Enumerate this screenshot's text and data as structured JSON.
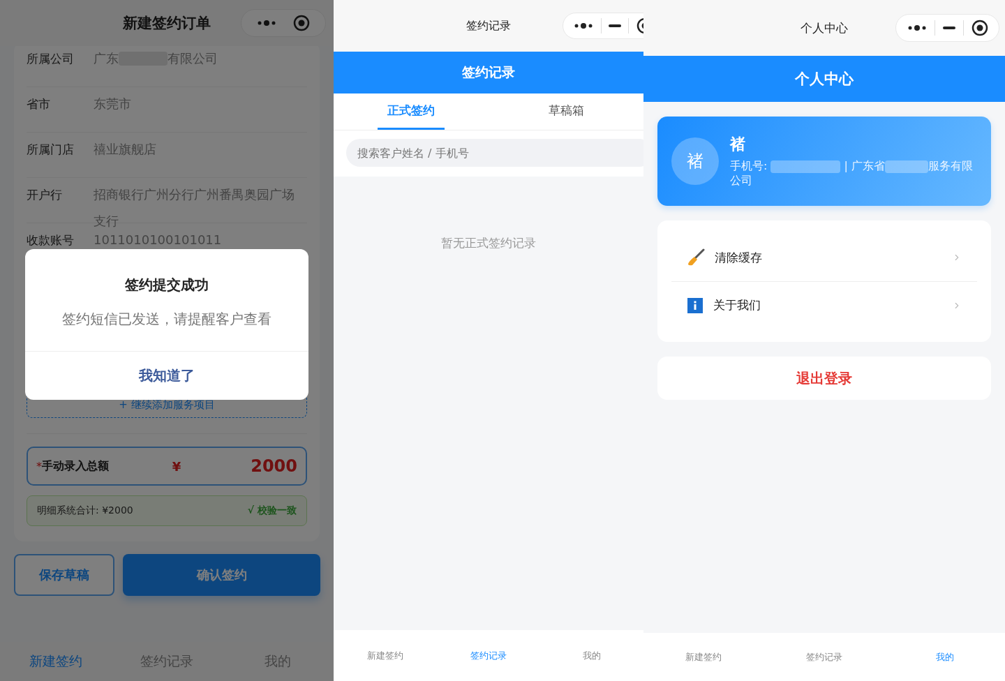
{
  "new_order_screen": {
    "nav_title": "新建签约订单",
    "fields": [
      {
        "label": "所属公司",
        "value": "广东",
        "value_after": "有限公司"
      },
      {
        "label": "省市",
        "value": "东莞市"
      },
      {
        "label": "所属门店",
        "value": "禧业旗舰店"
      },
      {
        "label": "开户行",
        "value": "招商银行广州分行广州番禺奥园广场支行"
      },
      {
        "label": "收款账号",
        "value": "1011010100101011"
      }
    ],
    "add_service": "+ 继续添加服务项目",
    "total": {
      "required_mark": "*",
      "label": "手动录入总额",
      "currency": "¥",
      "value": "2000"
    },
    "check": {
      "summary": "明细系统合计: ¥2000",
      "status": "√ 校验一致"
    },
    "buttons": [
      {
        "label": "保存草稿",
        "kind": "outline"
      },
      {
        "label": "确认签约",
        "kind": "primary"
      }
    ],
    "dialog": {
      "title": "签约提交成功",
      "message": "签约短信已发送，请提醒客户查看",
      "button": "我知道了"
    },
    "tab_bar": [
      {
        "label": "新建签约",
        "selected": true
      },
      {
        "label": "签约记录",
        "selected": false
      },
      {
        "label": "我的",
        "selected": false
      }
    ]
  },
  "records_screen": {
    "nav_title": "签约记录",
    "header": "签约记录",
    "tabs": [
      {
        "label": "正式签约",
        "selected": true
      },
      {
        "label": "草稿箱",
        "selected": false
      }
    ],
    "search": {
      "placeholder": "搜索客户姓名 / 手机号"
    },
    "empty_text": "暂无正式签约记录",
    "tab_bar": [
      {
        "label": "新建签约",
        "selected": false
      },
      {
        "label": "签约记录",
        "selected": true
      },
      {
        "label": "我的",
        "selected": false
      }
    ]
  },
  "profile_screen": {
    "nav_title": "个人中心",
    "header": "个人中心",
    "profile": {
      "avatar": "褚",
      "name": "褚",
      "phone_label": "手机号:",
      "company_prefix": "| 广东省",
      "company_suffix": "服务有限公司"
    },
    "menu": [
      {
        "label": "清除缓存",
        "kind": "broom"
      },
      {
        "label": "关于我们",
        "kind": "info"
      }
    ],
    "logout": "退出登录",
    "tab_bar": [
      {
        "label": "新建签约",
        "selected": false
      },
      {
        "label": "签约记录",
        "selected": false
      },
      {
        "label": "我的",
        "selected": true
      }
    ]
  }
}
